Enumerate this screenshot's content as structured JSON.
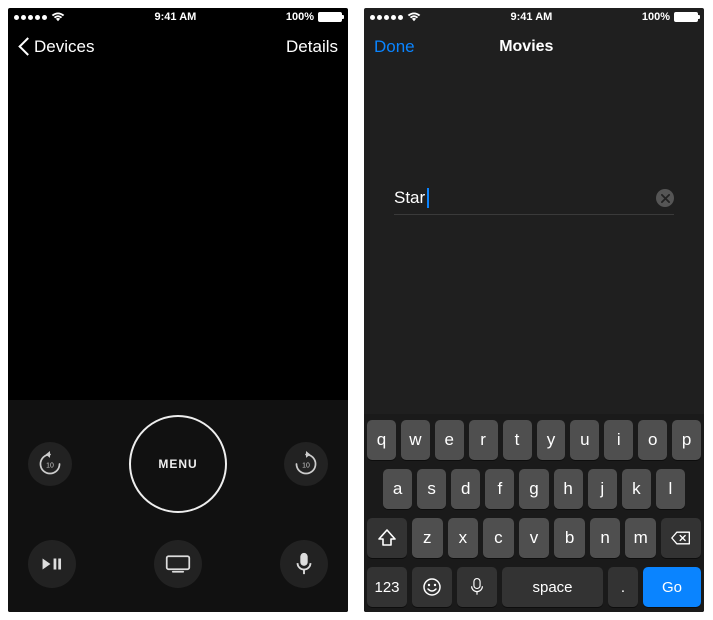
{
  "status": {
    "time": "9:41 AM",
    "battery_pct": "100%"
  },
  "screen1": {
    "back_label": "Devices",
    "details_label": "Details",
    "menu_label": "MENU",
    "skip_seconds": "10"
  },
  "screen2": {
    "done_label": "Done",
    "title": "Movies",
    "search_value": "Star"
  },
  "keyboard": {
    "rows": [
      [
        "q",
        "w",
        "e",
        "r",
        "t",
        "y",
        "u",
        "i",
        "o",
        "p"
      ],
      [
        "a",
        "s",
        "d",
        "f",
        "g",
        "h",
        "j",
        "k",
        "l"
      ],
      [
        "z",
        "x",
        "c",
        "v",
        "b",
        "n",
        "m"
      ]
    ],
    "num_label": "123",
    "space_label": "space",
    "dot_label": ".",
    "go_label": "Go"
  }
}
